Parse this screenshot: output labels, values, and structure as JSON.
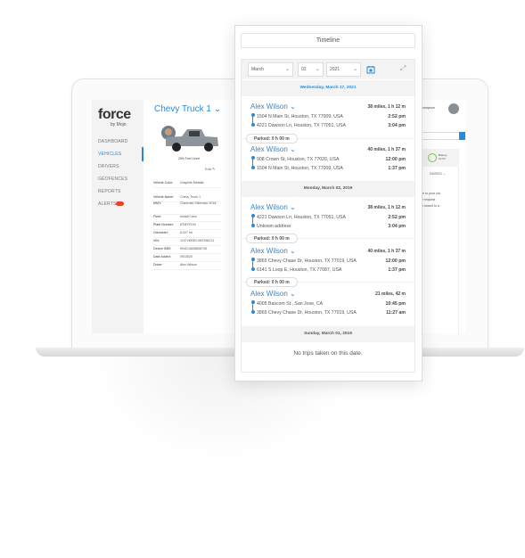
{
  "app": {
    "logo": "force",
    "logo_sub": "by Mojo",
    "user_name": "Todd Thompson"
  },
  "sidebar": {
    "items": [
      {
        "label": "DASHBOARD"
      },
      {
        "label": "VEHICLES",
        "active": true
      },
      {
        "label": "DRIVERS"
      },
      {
        "label": "GEOFENCES"
      },
      {
        "label": "REPORTS"
      },
      {
        "label": "ALERTS"
      }
    ],
    "alerts_badge": "5"
  },
  "vehicle": {
    "title": "Chevy Truck 1",
    "fuel_level": "25% Fuel Level",
    "edit_label": "Edit",
    "details": [
      {
        "k": "Vehicle Color:",
        "v": "Graphite Metallic"
      },
      {
        "k": "Vehicle Name:",
        "v": "Chevy Truck 1"
      },
      {
        "k": "MMY:",
        "v": "Chevrolet Silverado 2018"
      },
      {
        "k": "Fleet:",
        "v": "Install Crew"
      },
      {
        "k": "Plate Number:",
        "v": "8TMY5749"
      },
      {
        "k": "Odometer:",
        "v": "8,027 mi"
      },
      {
        "k": "VIN:",
        "v": "1GCVKREC4HZ356721"
      },
      {
        "k": "Device IMEI:",
        "v": "994214608806745"
      },
      {
        "k": "Date Added:",
        "v": "09/15/20"
      },
      {
        "k": "Driver:",
        "v": "Alex Wilson"
      }
    ]
  },
  "right": {
    "battery_label": "Battery",
    "battery_value": "12.6V",
    "date": "04/20/21",
    "text_lines": [
      "e to your car",
      "r request",
      "r towed to a"
    ]
  },
  "timeline": {
    "title": "Timeline",
    "month": "March",
    "day": "02",
    "year": "2021",
    "dates": [
      "Wednesday, March 17, 2021",
      "Monday, March 02, 2019",
      "Sunday, March 01, 2019"
    ],
    "trips": [
      {
        "driver": "Alex Wilson",
        "summary": "38 miles, 1 h 12 m",
        "from": "1504 N Main St, Houston, TX 77009, USA",
        "from_time": "2:52 pm",
        "to": "4221 Dawson Ln, Houston, TX 77051, USA",
        "to_time": "3:04 pm"
      },
      {
        "driver": "Alex Wilson",
        "summary": "40 miles, 1 h 37 m",
        "from": "908 Crown St, Houston, TX 77020, USA",
        "from_time": "12:00 pm",
        "to": "1504 N Main St, Houston, TX 77009, USA",
        "to_time": "1:37 pm"
      },
      {
        "driver": "Alex Wilson",
        "summary": "38 miles, 1 h 12 m",
        "from": "4221 Dawson Ln, Houston, TX 77051, USA",
        "from_time": "2:52 pm",
        "to": "Unkown address",
        "to_time": "3:04 pm"
      },
      {
        "driver": "Alex Wilson",
        "summary": "40 miles, 1 h 37 m",
        "from": "3865 Chevy Chase Dr, Houston, TX 77019, USA",
        "from_time": "12:00 pm",
        "to": "6141 S Loop E, Houston, TX 77087, USA",
        "to_time": "1:37 pm"
      },
      {
        "driver": "Alex Wilson",
        "summary": "21 miles, 42 m",
        "from": "4005 Bascom St., San Jose, CA",
        "from_time": "10:45 pm",
        "to": "3865 Chevy Chase Dr, Houston, TX 77019, USA",
        "to_time": "11:27 am"
      }
    ],
    "parked": "Parked: 0 h 00 m",
    "no_trips": "No trips taken on this date."
  },
  "colors": {
    "accent": "#2b8ad6",
    "alert": "#e8432f",
    "battery": "#7cc653"
  }
}
